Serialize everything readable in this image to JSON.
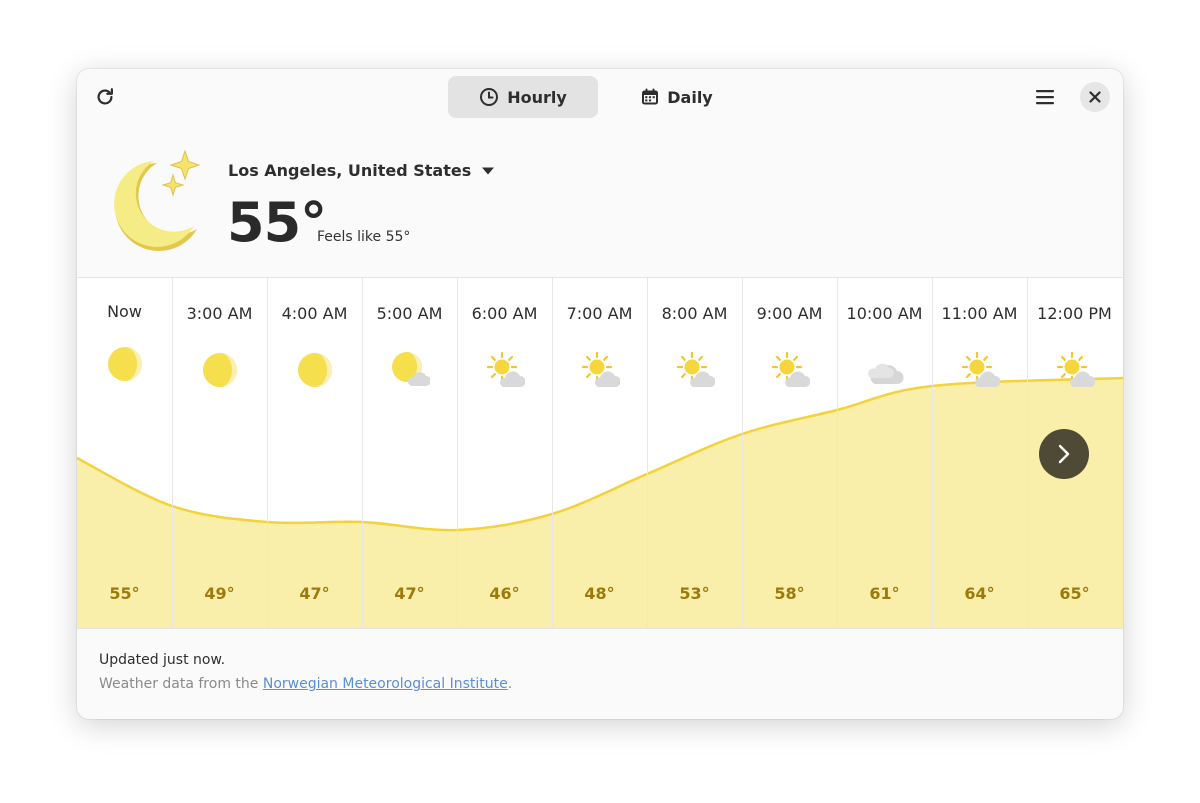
{
  "header": {
    "refresh_icon": "refresh-icon",
    "tabs": [
      {
        "label": "Hourly",
        "icon": "clock-icon",
        "active": true
      },
      {
        "label": "Daily",
        "icon": "calendar-icon",
        "active": false
      }
    ],
    "menu_icon": "hamburger-menu-icon",
    "close_icon": "close-icon"
  },
  "current": {
    "icon": "moon-stars-icon",
    "location": "Los Angeles, United States",
    "temperature": "55°",
    "feels_like": "Feels like 55°"
  },
  "hourly": {
    "items": [
      {
        "time": "Now",
        "icon": "moon-icon",
        "temp": "55°"
      },
      {
        "time": "3:00 AM",
        "icon": "moon-icon",
        "temp": "49°"
      },
      {
        "time": "4:00 AM",
        "icon": "moon-icon",
        "temp": "47°"
      },
      {
        "time": "5:00 AM",
        "icon": "moon-cloud-icon",
        "temp": "47°"
      },
      {
        "time": "6:00 AM",
        "icon": "sun-cloud-icon",
        "temp": "46°"
      },
      {
        "time": "7:00 AM",
        "icon": "sun-cloud-icon",
        "temp": "48°"
      },
      {
        "time": "8:00 AM",
        "icon": "sun-cloud-icon",
        "temp": "53°"
      },
      {
        "time": "9:00 AM",
        "icon": "sun-cloud-icon",
        "temp": "58°"
      },
      {
        "time": "10:00 AM",
        "icon": "cloud-icon",
        "temp": "61°"
      },
      {
        "time": "11:00 AM",
        "icon": "sun-cloud-icon",
        "temp": "64°"
      },
      {
        "time": "12:00 PM",
        "icon": "sun-cloud-icon",
        "temp": "65°"
      }
    ],
    "next_icon": "chevron-right-icon",
    "graph_color": "#f9eeaa",
    "graph_line_color": "#f3d23a"
  },
  "footer": {
    "updated": "Updated just now.",
    "source_prefix": "Weather data from the ",
    "source_link": "Norwegian Meteorological Institute",
    "source_suffix": "."
  },
  "colors": {
    "accent_moon": "#f6e777",
    "temp_text": "#9c7a0c",
    "link": "#5b8fd0"
  }
}
